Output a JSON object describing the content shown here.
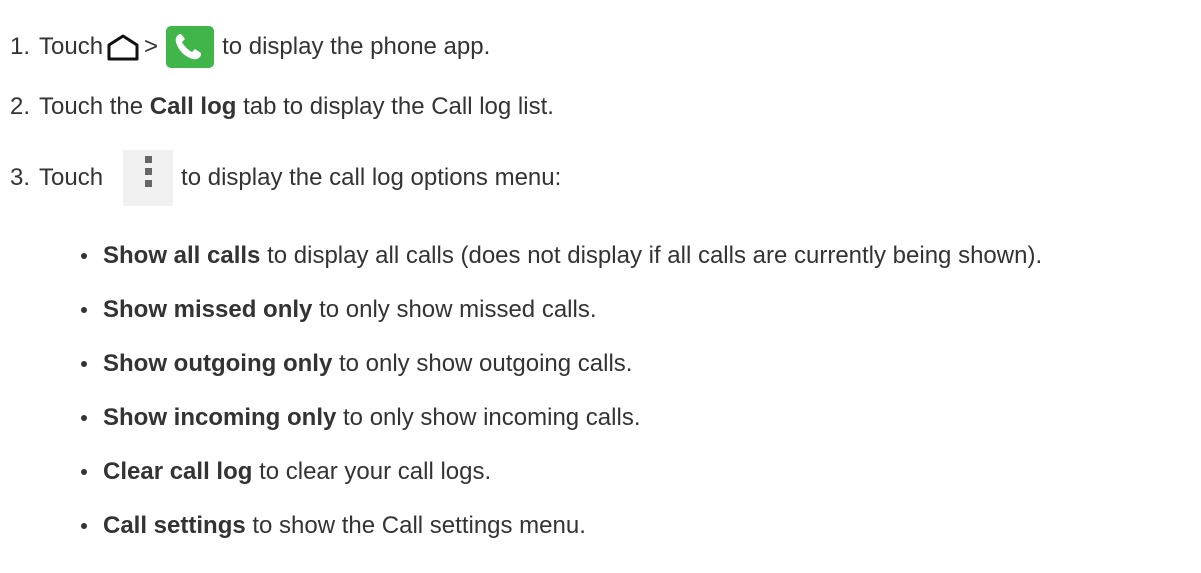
{
  "steps": [
    {
      "number": "1.",
      "text_before": "Touch",
      "separator": ">",
      "text_after": "to display the phone app.",
      "icons": [
        "home-icon",
        "phone-app-icon"
      ]
    },
    {
      "number": "2.",
      "text_before": "Touch the",
      "bold": "Call log",
      "text_after": "tab to display the Call log list."
    },
    {
      "number": "3.",
      "text_before": "Touch",
      "text_after": "to display the call log options menu:",
      "icons": [
        "overflow-menu-icon"
      ]
    }
  ],
  "options": [
    {
      "bold": "Show all calls",
      "text": "to display all calls (does not display if all calls are currently being shown)."
    },
    {
      "bold": "Show missed only",
      "text": "to only show missed calls."
    },
    {
      "bold": "Show outgoing only",
      "text": "to only show outgoing calls."
    },
    {
      "bold": "Show incoming only",
      "text": "to only show incoming calls."
    },
    {
      "bold": "Clear call log",
      "text": "to clear your call logs."
    },
    {
      "bold": "Call settings",
      "text": "to show the Call settings menu."
    }
  ],
  "colors": {
    "text": "#333333",
    "phone_icon_bg": "#3fb54a",
    "menu_icon_bg": "#f1f1f1",
    "menu_dots": "#666666"
  }
}
